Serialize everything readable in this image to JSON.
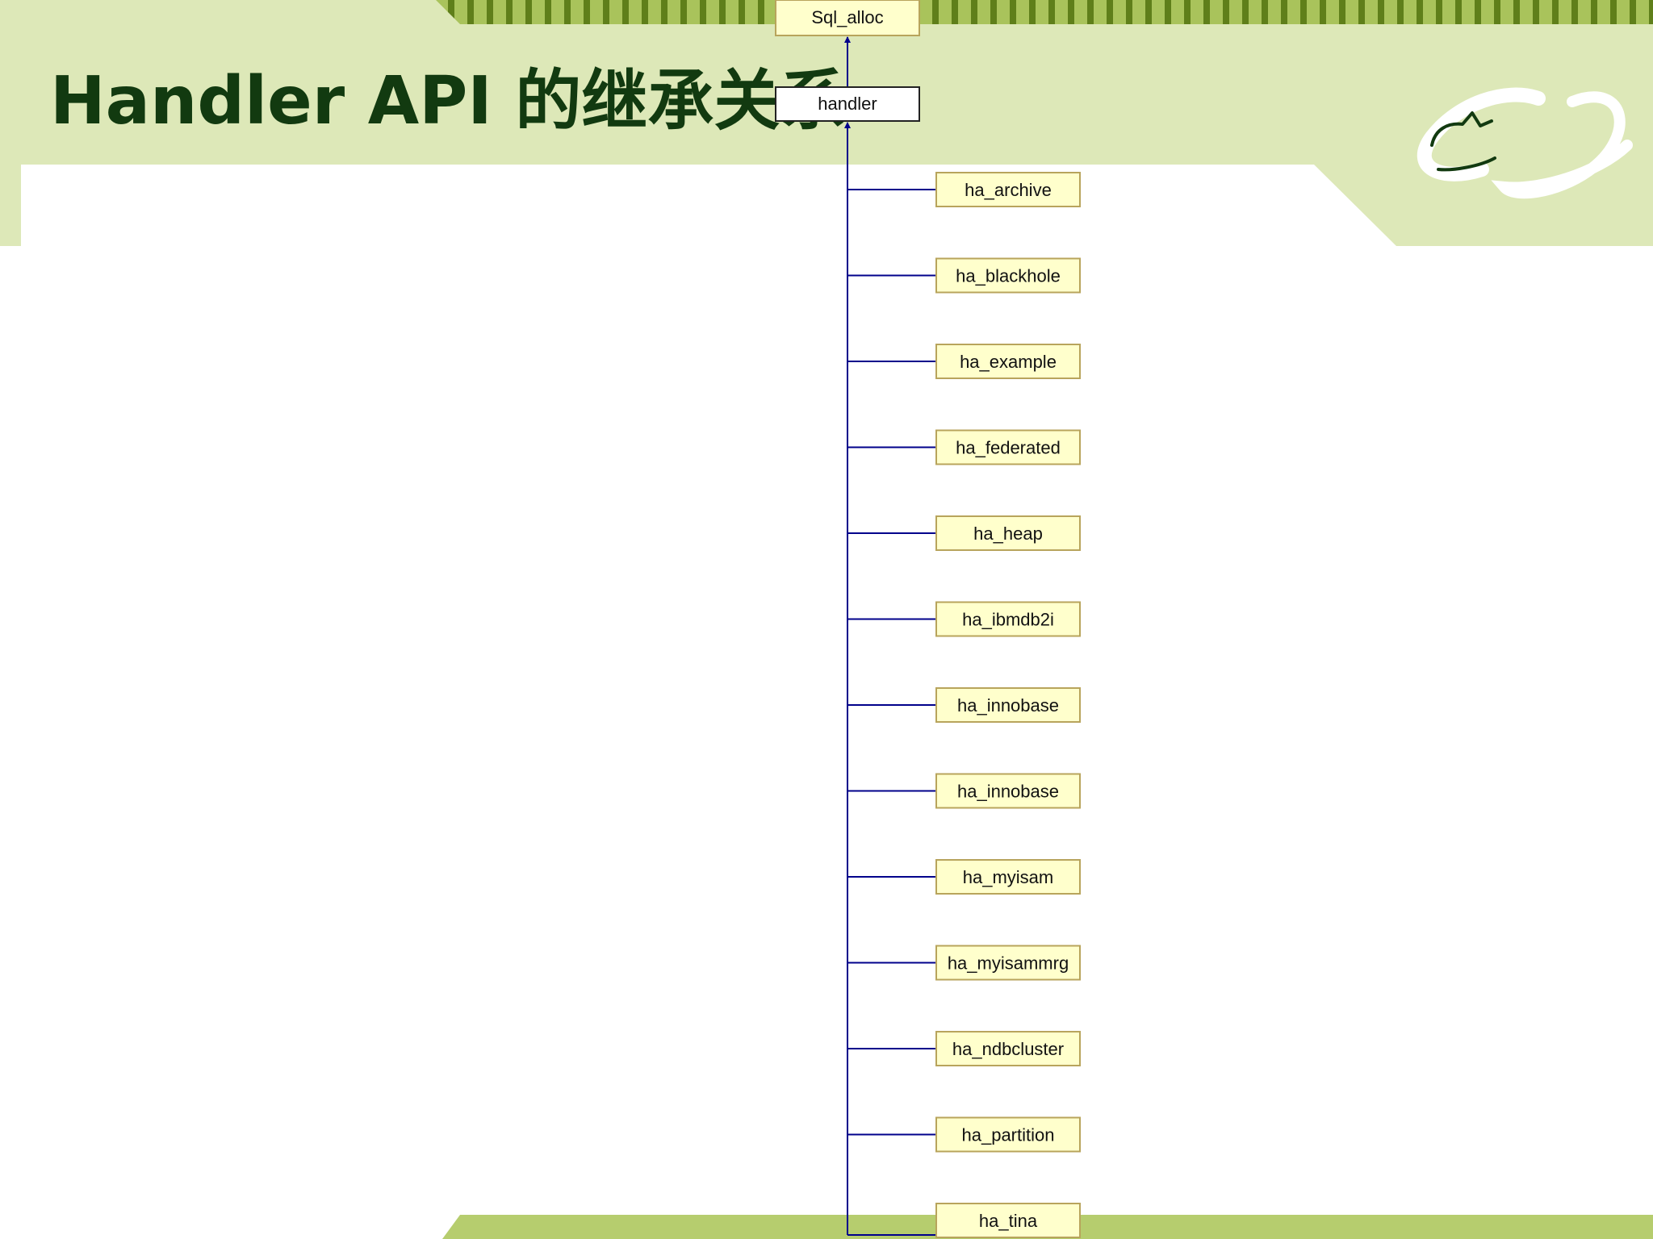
{
  "slide": {
    "title": "Handler API 的继承关系",
    "colors": {
      "header_band": "#dde8b8",
      "accent_green": "#a9c35b",
      "stripe_dark": "#5f7f1a",
      "title_text": "#123a10",
      "node_fill": "#ffffcc",
      "node_border": "#b8a45c",
      "connector": "#00008b"
    },
    "logo_icon": "alibaba-logo-icon"
  },
  "diagram": {
    "type": "class-inheritance-tree",
    "root": "Sql_alloc",
    "base": "handler",
    "children": [
      "ha_archive",
      "ha_blackhole",
      "ha_example",
      "ha_federated",
      "ha_heap",
      "ha_ibmdb2i",
      "ha_innobase",
      "ha_innobase",
      "ha_myisam",
      "ha_myisammrg",
      "ha_ndbcluster",
      "ha_partition",
      "ha_tina"
    ]
  }
}
